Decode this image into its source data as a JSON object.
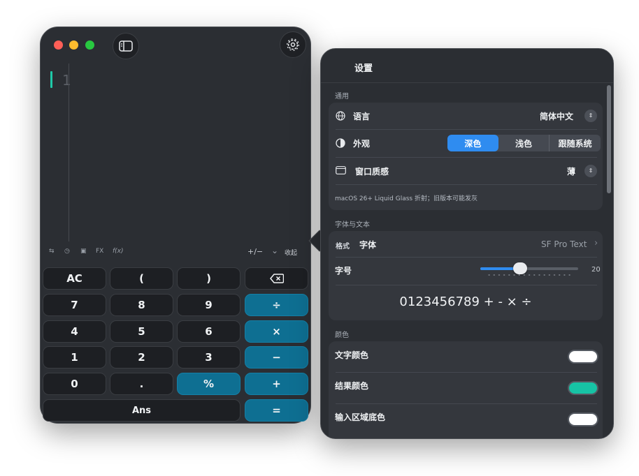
{
  "calculator": {
    "line_number": "1",
    "toolbar": {
      "swap_icon": "⇆",
      "history_icon": "◷",
      "memory_icon": "▣",
      "fx_label": "FX",
      "fxi_label": "f(x)",
      "sign_label": "+∕−",
      "collapse_chevron": "⌄",
      "collapse_label": "收起"
    },
    "keys": {
      "ac": "AC",
      "paren_open": "(",
      "paren_close": ")",
      "seven": "7",
      "eight": "8",
      "nine": "9",
      "divide": "÷",
      "four": "4",
      "five": "5",
      "six": "6",
      "multiply": "×",
      "one": "1",
      "two": "2",
      "three": "3",
      "minus": "−",
      "zero": "0",
      "dot": ".",
      "percent": "%",
      "plus": "+",
      "ans": "Ans",
      "equals": "="
    }
  },
  "settings": {
    "title": "设置",
    "general": {
      "section": "通用",
      "language_label": "语言",
      "language_value": "简体中文",
      "appearance_label": "外观",
      "appearance_options": [
        "深色",
        "浅色",
        "跟随系统"
      ],
      "appearance_selected": "深色",
      "texture_label": "窗口质感",
      "texture_value": "薄",
      "note": "macOS 26+ Liquid Glass 折射；旧版本可能发灰"
    },
    "font": {
      "section": "字体与文本",
      "format_tag": "格式",
      "font_label": "字体",
      "font_value": "SF Pro Text",
      "size_label": "字号",
      "size_value": "20",
      "size_fraction": 0.41,
      "preview": "0123456789 + - × ÷"
    },
    "colors": {
      "section": "颜色",
      "text_color_label": "文字颜色",
      "text_color": "#ffffff",
      "result_color_label": "结果颜色",
      "result_color": "#17c3a5",
      "input_bg_label": "输入区域底色",
      "input_bg_color": "#ffffff"
    },
    "accent": "#2f8cf0"
  }
}
